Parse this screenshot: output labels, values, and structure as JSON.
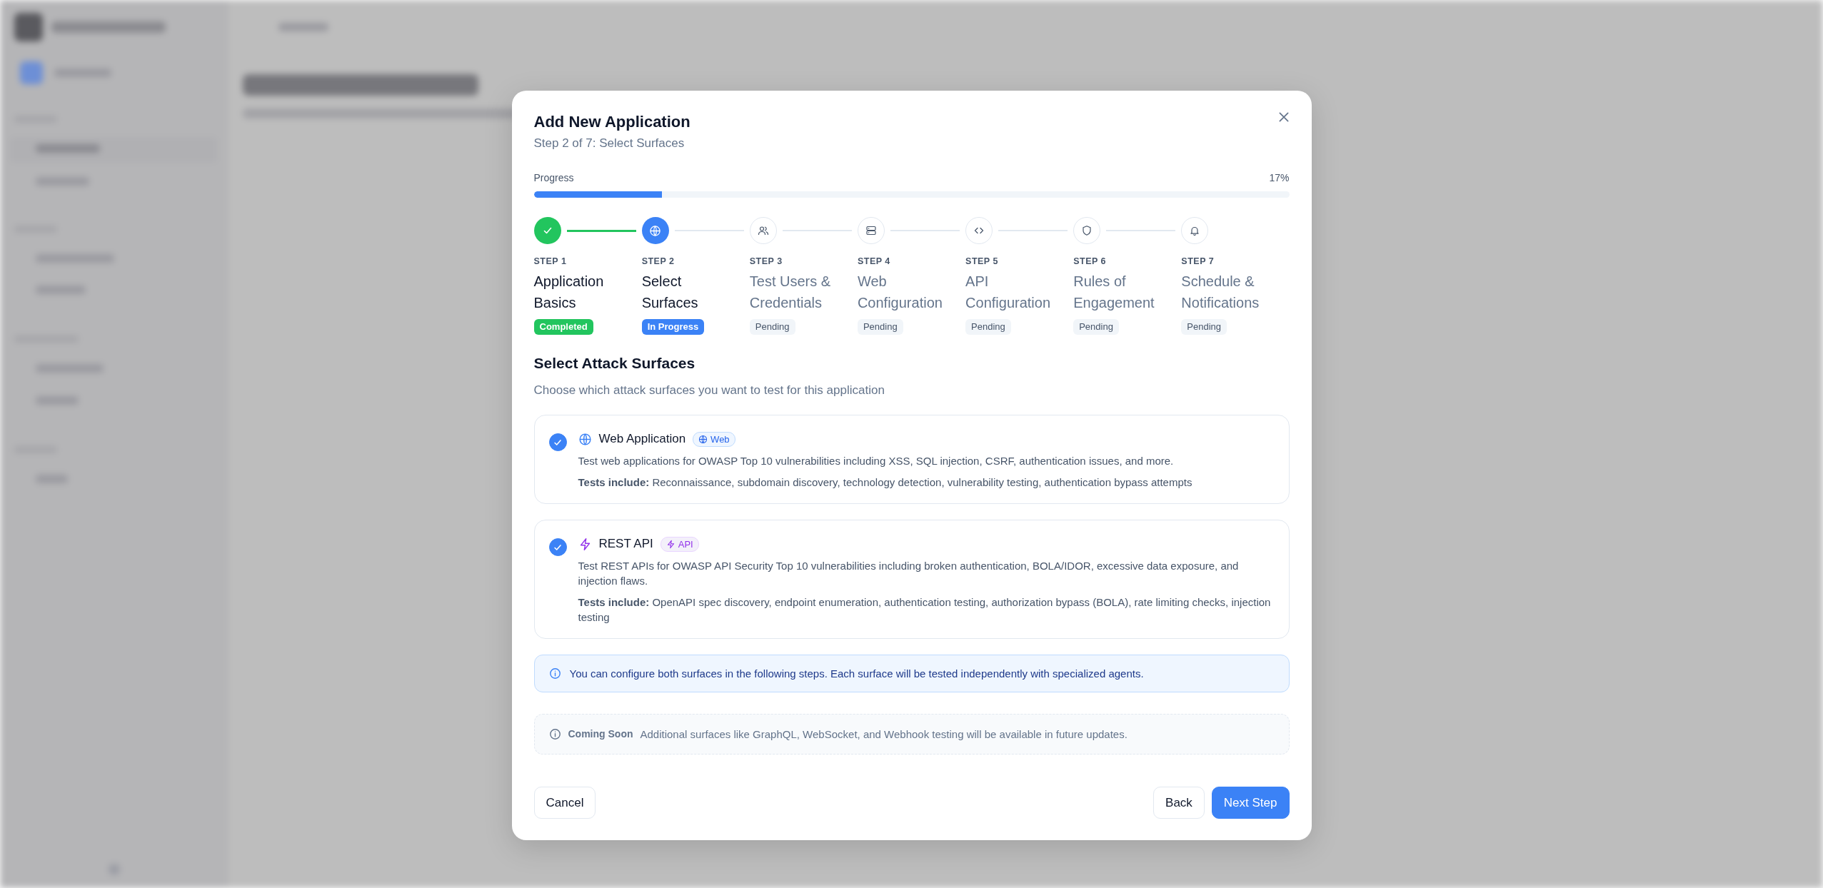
{
  "dialog": {
    "title": "Add New Application",
    "subtitle": "Step 2 of 7: Select Surfaces"
  },
  "progress": {
    "label": "Progress",
    "reading": "17%",
    "level": 0.17
  },
  "steps": [
    {
      "number": "STEP 1",
      "title": "Application Basics",
      "status": "Completed",
      "kind": "completed"
    },
    {
      "number": "STEP 2",
      "title": "Select Surfaces",
      "status": "In Progress",
      "kind": "in_progress"
    },
    {
      "number": "STEP 3",
      "title": "Test Users & Credentials",
      "status": "Pending",
      "kind": "pending"
    },
    {
      "number": "STEP 4",
      "title": "Web Configuration",
      "status": "Pending",
      "kind": "pending"
    },
    {
      "number": "STEP 5",
      "title": "API Configuration",
      "status": "Pending",
      "kind": "pending"
    },
    {
      "number": "STEP 6",
      "title": "Rules of Engagement",
      "status": "Pending",
      "kind": "pending"
    },
    {
      "number": "STEP 7",
      "title": "Schedule & Notifications",
      "status": "Pending",
      "kind": "pending"
    }
  ],
  "section": {
    "heading": "Select Attack Surfaces",
    "description": "Choose which attack surfaces you want to test for this application"
  },
  "surfaces": [
    {
      "kind": "web",
      "name": "Web Application",
      "tag": "Web",
      "checked": true,
      "description": "Test web applications for OWASP Top 10 vulnerabilities including XSS, SQL injection, CSRF, authentication issues, and more.",
      "tests_label": "Tests include:",
      "tests": "Reconnaissance, subdomain discovery, technology detection, vulnerability testing, authentication bypass attempts"
    },
    {
      "kind": "api",
      "name": "REST API",
      "tag": "API",
      "checked": true,
      "description": "Test REST APIs for OWASP API Security Top 10 vulnerabilities including broken authentication, BOLA/IDOR, excessive data exposure, and injection flaws.",
      "tests_label": "Tests include:",
      "tests": "OpenAPI spec discovery, endpoint enumeration, authentication testing, authorization bypass (BOLA), rate limiting checks, injection testing"
    }
  ],
  "info_note": "You can configure both surfaces in the following steps. Each surface will be tested independently with specialized agents.",
  "coming_soon": {
    "label": "Coming Soon",
    "text": "Additional surfaces like GraphQL, WebSocket, and Webhook testing will be available in future updates."
  },
  "buttons": {
    "cancel": "Cancel",
    "back": "Back",
    "next": "Next Step"
  }
}
